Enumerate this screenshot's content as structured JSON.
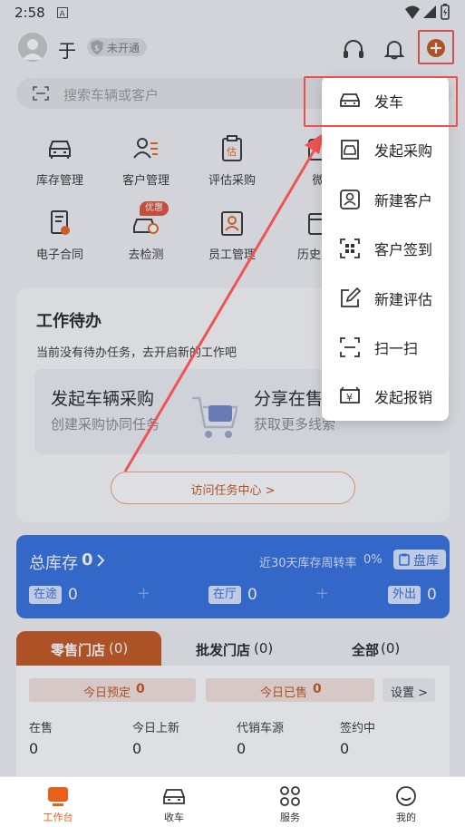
{
  "status": {
    "time": "2:58",
    "battery_icon": "battery-icon",
    "wifi_icon": "wifi-icon",
    "signal_icon": "signal-icon"
  },
  "header": {
    "user_name": "于",
    "badge": "未开通",
    "search_placeholder": "搜索车辆或客户"
  },
  "quick_actions": [
    "库存管理",
    "客户管理",
    "评估采购",
    "微",
    "电子合同",
    "去检测",
    "员工管理",
    "历史"
  ],
  "promo_tag": "优惠",
  "tasks": {
    "title": "工作待办",
    "empty_text": "当前没有待办任务，去开启新的工作吧",
    "card1_title": "发起车辆采购",
    "card1_sub": "创建采购协同任务",
    "card2_title": "分享在售",
    "card2_sub": "获取更多线索",
    "center_button": "访问任务中心 >"
  },
  "inventory": {
    "total_label": "总库存",
    "total_value": "0",
    "turnover_label": "近30天库存周转率",
    "turnover_value": "0%",
    "check_button": "盘库",
    "in_transit_label": "在途",
    "in_transit_value": "0",
    "in_hall_label": "在厅",
    "in_hall_value": "0",
    "out_label": "外出",
    "out_value": "0"
  },
  "store_tabs": {
    "retail": "零售门店",
    "retail_count": "(0)",
    "wholesale": "批发门店",
    "wholesale_count": "(0)",
    "all": "全部",
    "all_count": "(0)"
  },
  "today": {
    "booked_label": "今日预定",
    "booked_value": "0",
    "sold_label": "今日已售",
    "sold_value": "0",
    "settings": "设置 >"
  },
  "stats": [
    {
      "label": "在售",
      "value": "0"
    },
    {
      "label": "今日上新",
      "value": "0"
    },
    {
      "label": "代销车源",
      "value": "0"
    },
    {
      "label": "签约中",
      "value": "0"
    }
  ],
  "bottom_tabs": [
    "工作台",
    "收车",
    "服务",
    "我的"
  ],
  "dropdown": [
    "发车",
    "发起采购",
    "新建客户",
    "客户签到",
    "新建评估",
    "扫一扫",
    "发起报销"
  ],
  "colors": {
    "brand_orange": "#e8601c",
    "inventory_blue": "#2f6de0",
    "highlight_red": "#ef4f4f"
  }
}
